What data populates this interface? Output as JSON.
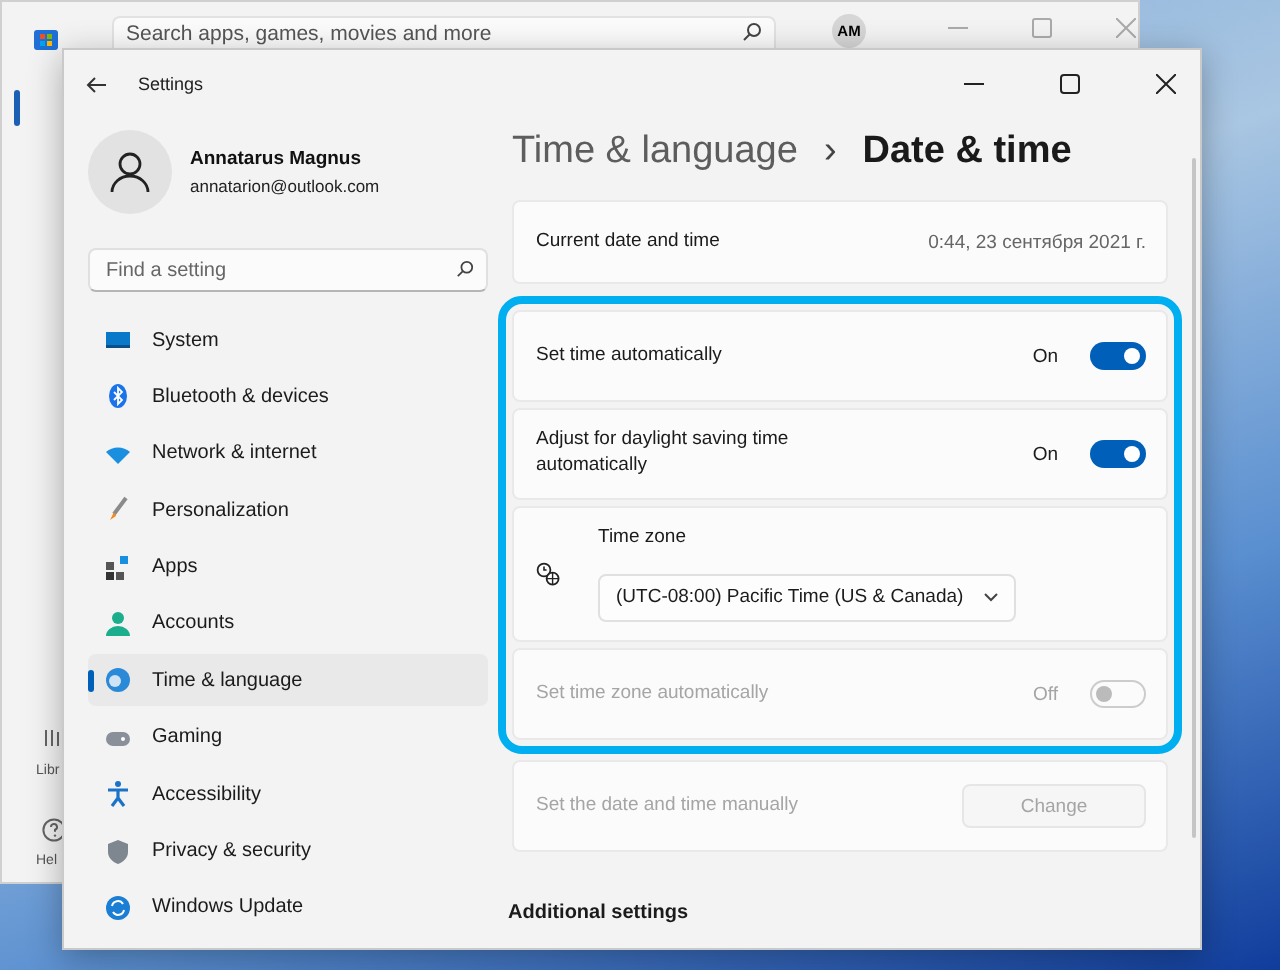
{
  "store": {
    "search": {
      "placeholder": "Search apps, games, movies and more"
    },
    "avatar": "AM",
    "rail_labels": [
      "Libr",
      "Hel"
    ]
  },
  "settings": {
    "title": "Settings",
    "user": {
      "name": "Annatarus Magnus",
      "email": "annatarion@outlook.com"
    },
    "search": {
      "placeholder": "Find a setting"
    },
    "nav": [
      {
        "label": "System",
        "selected": false
      },
      {
        "label": "Bluetooth & devices",
        "selected": false
      },
      {
        "label": "Network & internet",
        "selected": false
      },
      {
        "label": "Personalization",
        "selected": false
      },
      {
        "label": "Apps",
        "selected": false
      },
      {
        "label": "Accounts",
        "selected": false
      },
      {
        "label": "Time & language",
        "selected": true
      },
      {
        "label": "Gaming",
        "selected": false
      },
      {
        "label": "Accessibility",
        "selected": false
      },
      {
        "label": "Privacy & security",
        "selected": false
      },
      {
        "label": "Windows Update",
        "selected": false
      }
    ],
    "breadcrumb": {
      "parent": "Time & language",
      "separator": "›",
      "current": "Date & time"
    },
    "rows": [
      {
        "kind": "info",
        "label": "Current date and time",
        "value": "0:44, 23 сентября 2021 г."
      },
      {
        "kind": "group",
        "highlighted": true,
        "items": [
          {
            "kind": "toggle",
            "label": "Set time automatically",
            "state_text": "On",
            "on": true,
            "disabled": false
          },
          {
            "kind": "toggle",
            "label": "Adjust for daylight saving time automatically",
            "state_text": "On",
            "on": true,
            "disabled": false
          },
          {
            "kind": "dropdown",
            "label": "Time zone",
            "value": "(UTC-08:00) Pacific Time (US & Canada)"
          },
          {
            "kind": "toggle",
            "label": "Set time zone automatically",
            "state_text": "Off",
            "on": false,
            "disabled": true
          }
        ]
      },
      {
        "kind": "button",
        "label": "Set the date and time manually",
        "button": "Change",
        "disabled": true
      }
    ],
    "section_heading": "Additional settings"
  }
}
